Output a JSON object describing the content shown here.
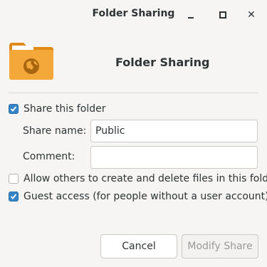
{
  "window": {
    "title": "Folder Sharing",
    "controls": {
      "minimize": "minimize-icon",
      "maximize": "maximize-icon",
      "close": "close-icon"
    }
  },
  "header": {
    "icon": "folder-share-icon",
    "title": "Folder Sharing"
  },
  "options": {
    "share_this_folder": {
      "label": "Share this folder",
      "checked": true
    },
    "allow_others": {
      "label": "Allow others to create and delete files in this folder",
      "checked": false
    },
    "guest_access": {
      "label": "Guest access (for people without a user account)",
      "checked": true
    }
  },
  "fields": {
    "share_name": {
      "label": "Share name:",
      "value": "Public"
    },
    "comment": {
      "label": "Comment:",
      "value": ""
    }
  },
  "buttons": {
    "cancel": "Cancel",
    "modify": "Modify Share"
  },
  "colors": {
    "accent": "#3584c8",
    "folder": "#f4a83a",
    "folder_dark": "#e08a1a"
  }
}
